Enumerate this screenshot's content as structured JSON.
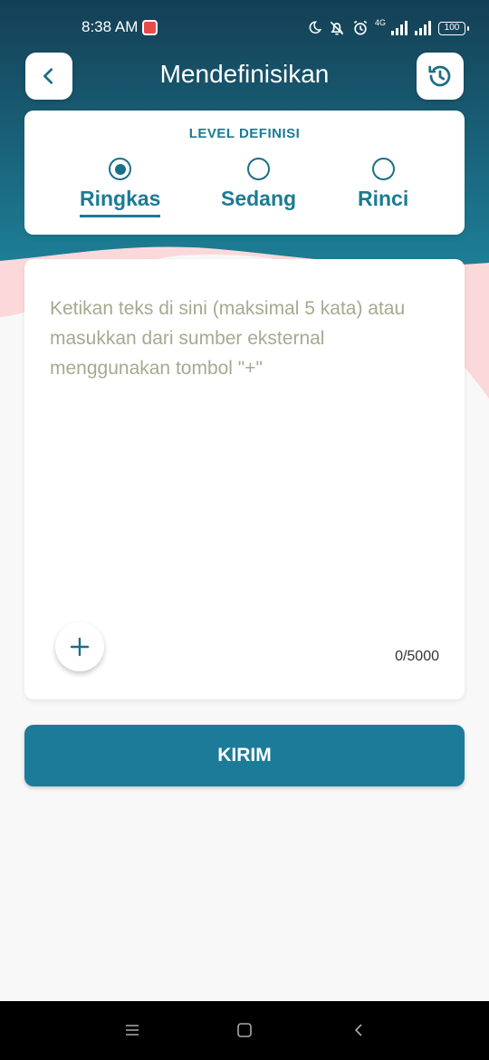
{
  "status_bar": {
    "time": "8:38 AM",
    "signal_label": "4G",
    "battery": "100"
  },
  "header": {
    "title": "Mendefinisikan",
    "back_icon": "chevron-left-icon",
    "history_icon": "history-icon"
  },
  "level": {
    "title": "LEVEL DEFINISI",
    "options": [
      {
        "label": "Ringkas",
        "selected": true
      },
      {
        "label": "Sedang",
        "selected": false
      },
      {
        "label": "Rinci",
        "selected": false
      }
    ]
  },
  "input": {
    "value": "",
    "placeholder": "Ketikan teks di sini (maksimal 5 kata) atau masukkan dari sumber eksternal menggunakan tombol \"+\"",
    "add_icon": "plus-icon",
    "char_count": "0/5000"
  },
  "submit": {
    "label": "KIRIM"
  },
  "colors": {
    "primary": "#1c7b98",
    "header_dark": "#144a60",
    "accent_pink": "#fbd9da",
    "placeholder": "#a8a891"
  }
}
